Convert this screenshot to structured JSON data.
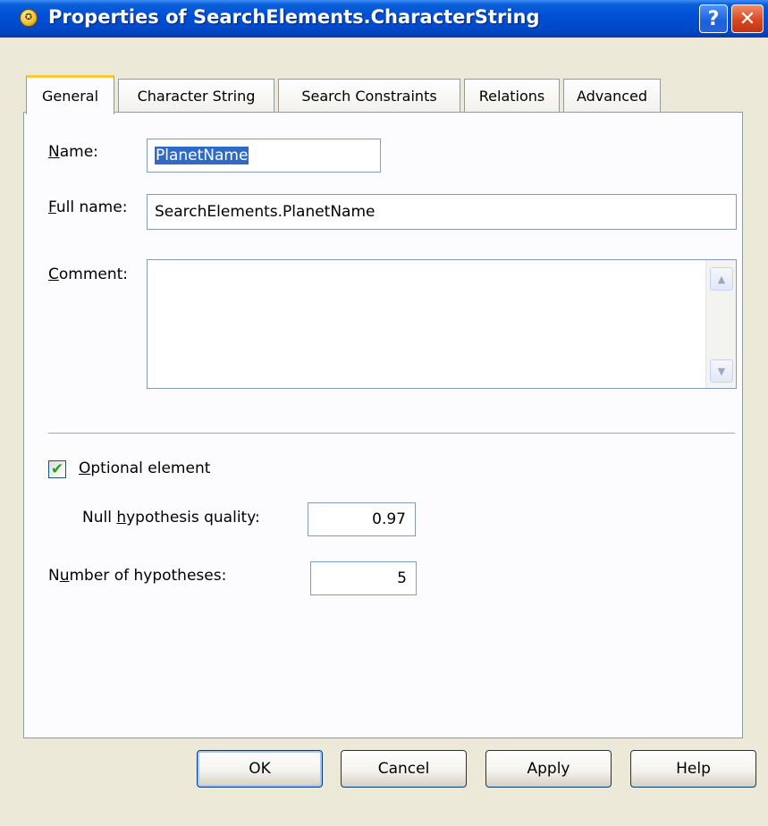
{
  "window": {
    "title": "Properties of SearchElements.CharacterString",
    "app_icon": "app-icon",
    "help_glyph": "?",
    "close_glyph": "✕"
  },
  "tabs": [
    {
      "label": "General",
      "active": true
    },
    {
      "label": "Character String",
      "active": false
    },
    {
      "label": "Search Constraints",
      "active": false
    },
    {
      "label": "Relations",
      "active": false
    },
    {
      "label": "Advanced",
      "active": false
    }
  ],
  "general": {
    "name_label_accel": "N",
    "name_label_rest": "ame:",
    "name_value": "PlanetName",
    "fullname_label_accel": "F",
    "fullname_label_rest": "ull name:",
    "fullname_value": "SearchElements.PlanetName",
    "comment_label_accel": "C",
    "comment_label_rest": "omment:",
    "comment_value": "",
    "optional_checked": true,
    "optional_label_accel": "O",
    "optional_label_rest": "ptional element",
    "null_label_pre": "Null ",
    "null_label_accel": "h",
    "null_label_post": "ypothesis quality:",
    "null_value": "0.97",
    "num_label_pre": "N",
    "num_label_accel": "u",
    "num_label_post": "mber of hypotheses:",
    "num_value": "5"
  },
  "buttons": {
    "ok": "OK",
    "cancel": "Cancel",
    "apply": "Apply",
    "help": "Help"
  },
  "colors": {
    "titlebar": "#0050d6",
    "selection": "#316ac5",
    "tab_highlight": "#ffc73d",
    "dialog_bg": "#ece9d8"
  }
}
